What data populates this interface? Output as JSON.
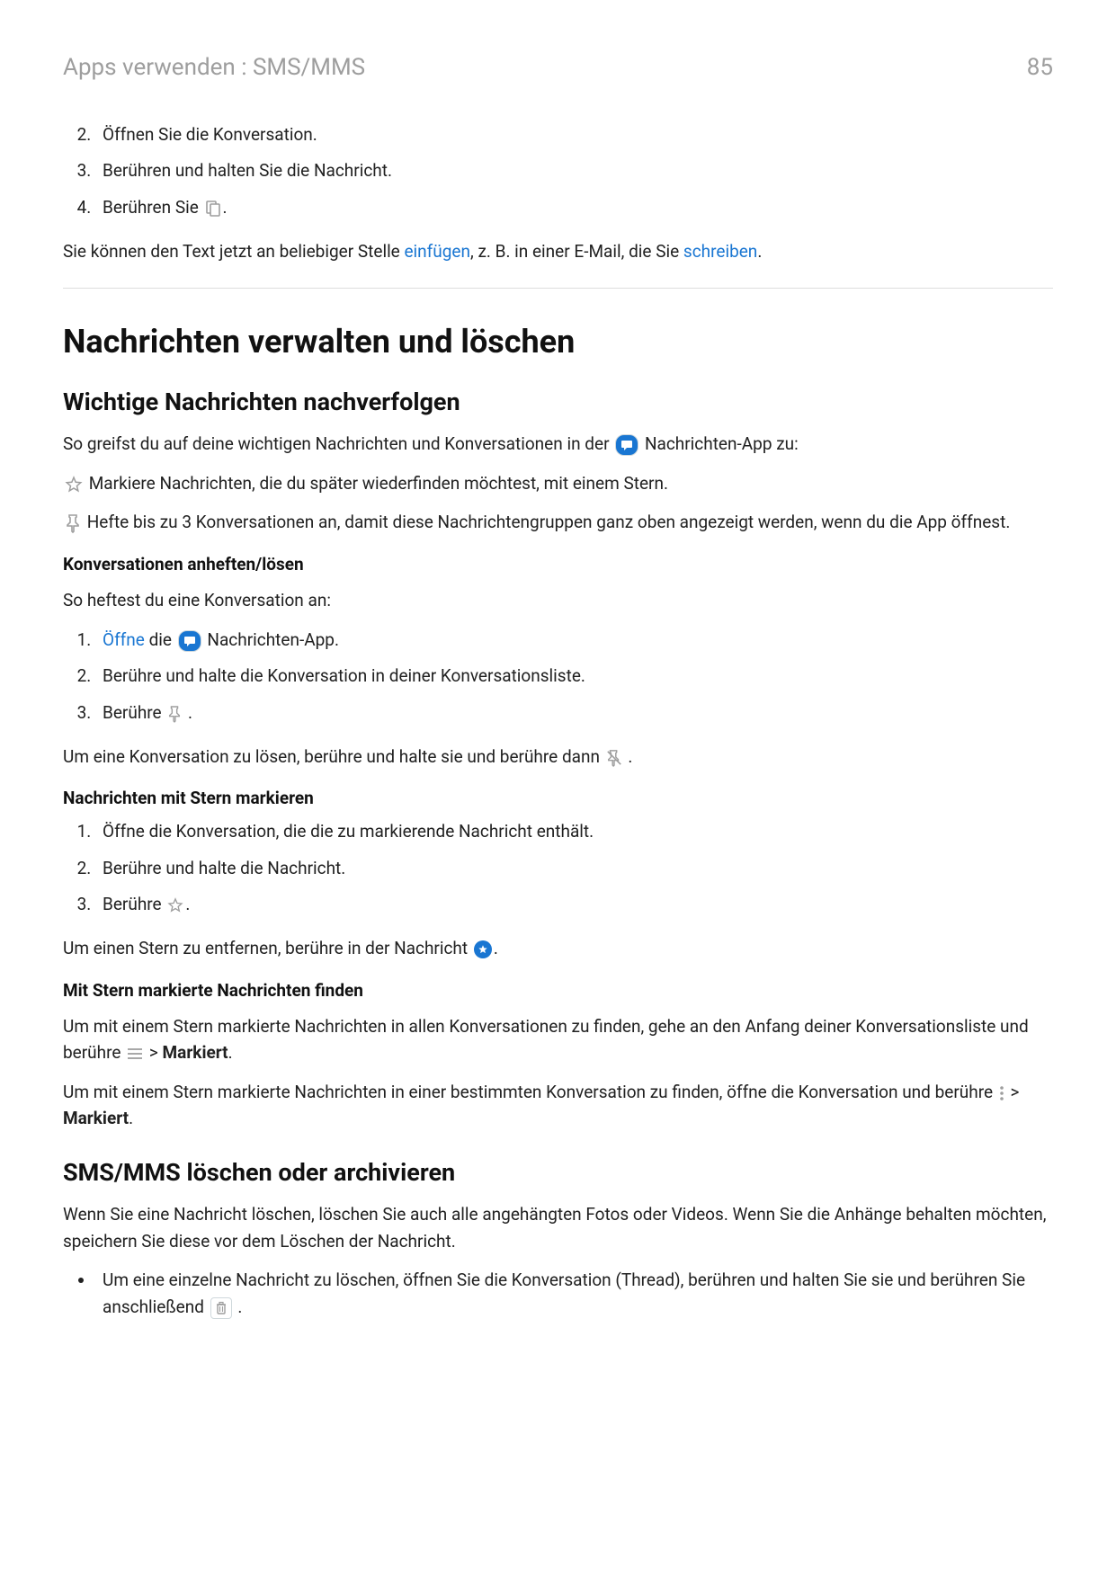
{
  "header": {
    "breadcrumb": "Apps verwenden : SMS/MMS",
    "page_number": "85"
  },
  "top_steps": {
    "item2": "Öffnen Sie die Konversation.",
    "item3": "Berühren und halten Sie die Nachricht.",
    "item4_prefix": "Berühren Sie ",
    "item4_suffix": "."
  },
  "paste_para": {
    "t1": "Sie können den Text jetzt an beliebiger Stelle ",
    "link1": "einfügen",
    "t2": ", z. B. in einer E-Mail, die Sie ",
    "link2": "schreiben",
    "t3": "."
  },
  "h1": "Nachrichten verwalten und löschen",
  "h2a": "Wichtige Nachrichten nachverfolgen",
  "intro_follow": {
    "t1": "So greifst du auf deine wichtigen Nachrichten und Konversationen in der ",
    "t2": " Nachrichten-App zu:"
  },
  "star_line": " Markiere Nachrichten, die du später wiederfinden möchtest, mit einem Stern.",
  "pin_line": " Hefte bis zu 3 Konversationen an, damit diese Nachrichtengruppen ganz oben angezeigt werden, wenn du die App öffnest.",
  "h3a": "Konversationen anheften/lösen",
  "pin_intro": "So heftest du eine Konversation an:",
  "pin_steps": {
    "s1_link": "Öffne",
    "s1_mid": " die ",
    "s1_suffix": " Nachrichten-App.",
    "s2": "Berühre und halte die Konversation in deiner Konversationsliste.",
    "s3_prefix": "Berühre ",
    "s3_suffix": " ."
  },
  "unpin_para": {
    "t1": "Um eine Konversation zu lösen, berühre und halte sie und berühre dann ",
    "t2": " ."
  },
  "h3b": "Nachrichten mit Stern markieren",
  "star_steps": {
    "s1": "Öffne die Konversation, die die zu markierende Nachricht enthält.",
    "s2": "Berühre und halte die Nachricht.",
    "s3_prefix": "Berühre ",
    "s3_suffix": "."
  },
  "unstar_para": {
    "t1": "Um einen Stern zu entfernen, berühre in der Nachricht ",
    "t2": "."
  },
  "h3c": "Mit Stern markierte Nachrichten finden",
  "find_all": {
    "t1": "Um mit einem Stern markierte Nachrichten in allen Konversationen zu finden, gehe an den Anfang deiner Konversationsliste und berühre ",
    "t2": " > ",
    "bold": "Markiert",
    "t3": "."
  },
  "find_one": {
    "t1": "Um mit einem Stern markierte Nachrichten in einer bestimmten Konversation zu finden, öffne die Konversation und berühre ",
    "t2": " > ",
    "bold": "Markiert",
    "t3": "."
  },
  "h2b": "SMS/MMS löschen oder archivieren",
  "delete_intro": "Wenn Sie eine Nachricht löschen, löschen Sie auch alle angehängten Fotos oder Videos. Wenn Sie die Anhänge behalten möchten, speichern Sie diese vor dem Löschen der Nachricht.",
  "delete_bullet": {
    "t1": "Um eine einzelne Nachricht zu löschen, öffnen Sie die Konversation (Thread), berühren und halten Sie sie und berühren Sie anschließend ",
    "t2": " ."
  }
}
